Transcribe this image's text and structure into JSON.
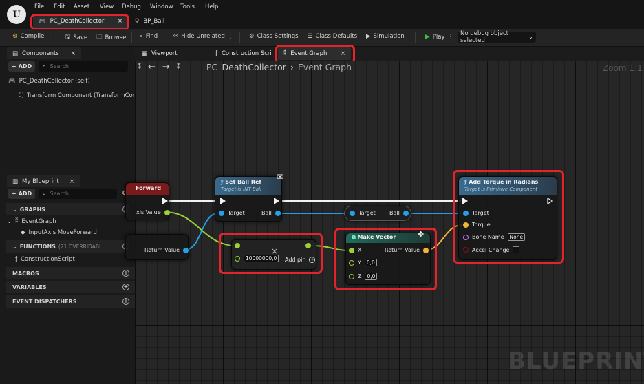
{
  "menu": [
    "File",
    "Edit",
    "Asset",
    "View",
    "Debug",
    "Window",
    "Tools",
    "Help"
  ],
  "tabs": {
    "active": "PC_DeathCollector",
    "other": "BP_Ball",
    "close": "×"
  },
  "toolbar": {
    "compile": "Compile",
    "save": "Save",
    "browse": "Browse",
    "find": "Find",
    "hide_unrelated": "Hide Unrelated",
    "class_settings": "Class Settings",
    "class_defaults": "Class Defaults",
    "simulation": "Simulation",
    "play": "Play",
    "debug_object": "No debug object selected"
  },
  "components": {
    "tab": "Components",
    "add": "ADD",
    "search_placeholder": "Search",
    "self": "PC_DeathCollector (self)",
    "transform": "Transform Component (TransformComp"
  },
  "my_blueprint": {
    "tab": "My Blueprint",
    "add": "ADD",
    "search_placeholder": "Search",
    "graphs": "GRAPHS",
    "event_graph": "EventGraph",
    "input_axis": "InputAxis MoveForward",
    "functions": "FUNCTIONS",
    "functions_note": "(21 OVERRIDABL",
    "construction": "ConstructionScript",
    "macros": "MACROS",
    "variables": "VARIABLES",
    "dispatchers": "EVENT DISPATCHERS"
  },
  "editor_tabs": {
    "viewport": "Viewport",
    "construction": "Construction Scri",
    "event_graph": "Event Graph"
  },
  "graph": {
    "breadcrumb_root": "PC_DeathCollector",
    "breadcrumb_sep": "›",
    "breadcrumb_leaf": "Event Graph",
    "zoom": "Zoom 1:1",
    "watermark": "BLUEPRINT",
    "nodes": {
      "forward": {
        "title": "Forward",
        "axis_value": "xis Value"
      },
      "getter": {
        "return_value": "Return Value"
      },
      "set_ball": {
        "title": "Set Ball Ref",
        "subtitle": "Target is INT Ball",
        "target": "Target",
        "ball": "Ball"
      },
      "ball_var": {
        "target": "Target",
        "ball": "Ball"
      },
      "multiply": {
        "value": "10000000,0",
        "add_pin": "Add pin",
        "op": "×"
      },
      "make_vector": {
        "title": "Make Vector",
        "x": "X",
        "y": "Y",
        "y_val": "0,0",
        "z": "Z",
        "z_val": "0,0",
        "return_value": "Return Value"
      },
      "add_torque": {
        "title": "Add Torque in Radians",
        "subtitle": "Target is Primitive Component",
        "target": "Target",
        "torque": "Torque",
        "bone_name": "Bone Name",
        "bone_value": "None",
        "accel_change": "Accel Change"
      }
    }
  },
  "colors": {
    "highlight": "#e4242c",
    "exec_wire": "#f2f2f2",
    "float_wire": "#9ccf3a",
    "object_wire": "#23a0e6",
    "vector_wire": "#f0b43a",
    "name_pin": "#c27cff",
    "bool_pin": "#8c1010"
  }
}
